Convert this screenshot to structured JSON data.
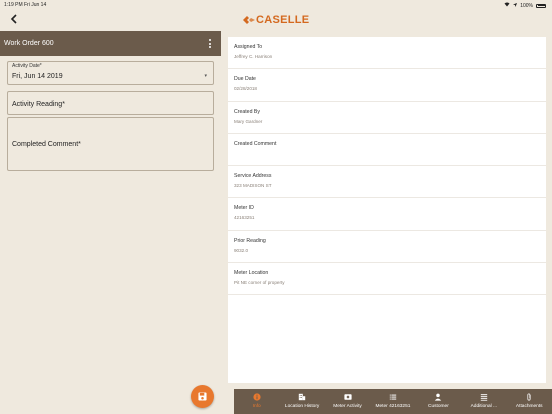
{
  "status_bar": {
    "time": "1:19 PM",
    "date": "Fri Jun 14",
    "battery": "100%"
  },
  "brand": {
    "name": "CASELLE",
    "accent": "#d4691f"
  },
  "work_order": {
    "title": "Work Order 600"
  },
  "form": {
    "activity_date": {
      "label": "Activity Date*",
      "value": "Fri, Jun 14 2019"
    },
    "activity_reading": {
      "placeholder": "Activity Reading*"
    },
    "completed_comment": {
      "placeholder": "Completed Comment*"
    }
  },
  "details": [
    {
      "label": "Assigned To",
      "value": "Jeffrey C. Harrison"
    },
    {
      "label": "Due Date",
      "value": "02/28/2018"
    },
    {
      "label": "Created By",
      "value": "Mary Gardner"
    },
    {
      "label": "Created Comment",
      "value": ""
    },
    {
      "label": "Service Address",
      "value": "323 MADISON ST"
    },
    {
      "label": "Meter ID",
      "value": "42163251"
    },
    {
      "label": "Prior Reading",
      "value": "9032.0"
    },
    {
      "label": "Meter Location",
      "value": "Pit NE corner of property"
    }
  ],
  "tabs": [
    {
      "label": "Info",
      "icon": "info-icon"
    },
    {
      "label": "Location History",
      "icon": "building-icon"
    },
    {
      "label": "Meter Activity",
      "icon": "meter-activity-icon"
    },
    {
      "label": "Meter 42163251",
      "icon": "list-icon"
    },
    {
      "label": "Customer",
      "icon": "person-icon"
    },
    {
      "label": "Additional ...",
      "icon": "list-lines-icon"
    },
    {
      "label": "Attachments",
      "icon": "paperclip-icon"
    }
  ],
  "colors": {
    "header": "#6b5b4b",
    "background": "#efe9de",
    "accent": "#e8782e"
  }
}
